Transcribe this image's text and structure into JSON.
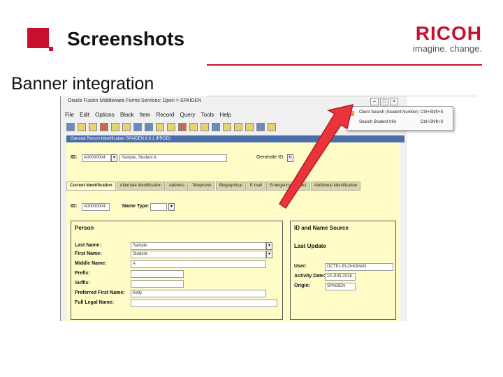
{
  "slide": {
    "title": "Screenshots",
    "subtitle": "Banner integration",
    "logo_word": "RICOH",
    "logo_tagline": "imagine. change.",
    "accent": "#c8102e"
  },
  "app": {
    "window_title": "Oracle Fusion Middleware Forms Services: Open > SPAIDEN",
    "menu": [
      "File",
      "Edit",
      "Options",
      "Block",
      "Item",
      "Record",
      "Query",
      "Tools",
      "Help"
    ],
    "form_title": "General Person Identification SPAIDEN 8.9.1 (PROD)",
    "key_block": {
      "id_label": "ID:",
      "id_value": "A00000004",
      "name_value": "Sample, Student A.",
      "generate_label": "Generate ID:"
    },
    "tabs": [
      "Current Identification",
      "Alternate Identification",
      "Address",
      "Telephone",
      "Biographical",
      "E-mail",
      "Emergency Contact",
      "Additional Identification"
    ],
    "current_id": {
      "id_label": "ID:",
      "id_value": "A00000004",
      "name_type_label": "Name Type:"
    },
    "person": {
      "header": "Person",
      "last_name_label": "Last Name:",
      "last_name": "Sample",
      "first_name_label": "First Name:",
      "first_name": "Student",
      "middle_name_label": "Middle Name:",
      "middle_name": "A",
      "prefix_label": "Prefix:",
      "suffix_label": "Suffix:",
      "preferred_label": "Preferred First Name:",
      "preferred": "Kelly",
      "full_legal_label": "Full Legal Name:"
    },
    "source": {
      "header": "ID and Name Source",
      "last_update_label": "Last Update",
      "user_label": "User:",
      "user": "OCTEL-ELOHOMAN",
      "activity_label": "Activity Date:",
      "activity": "10-JUN-2016",
      "origin_label": "Origin:",
      "origin": "SPAIDEN"
    },
    "popup": {
      "item1": "Client Search (Student Number)",
      "item1_shortcut": "Ctrl+Shift+S",
      "item2": "Search Student Info",
      "item2_shortcut": "Ctrl+Shift+S"
    }
  }
}
